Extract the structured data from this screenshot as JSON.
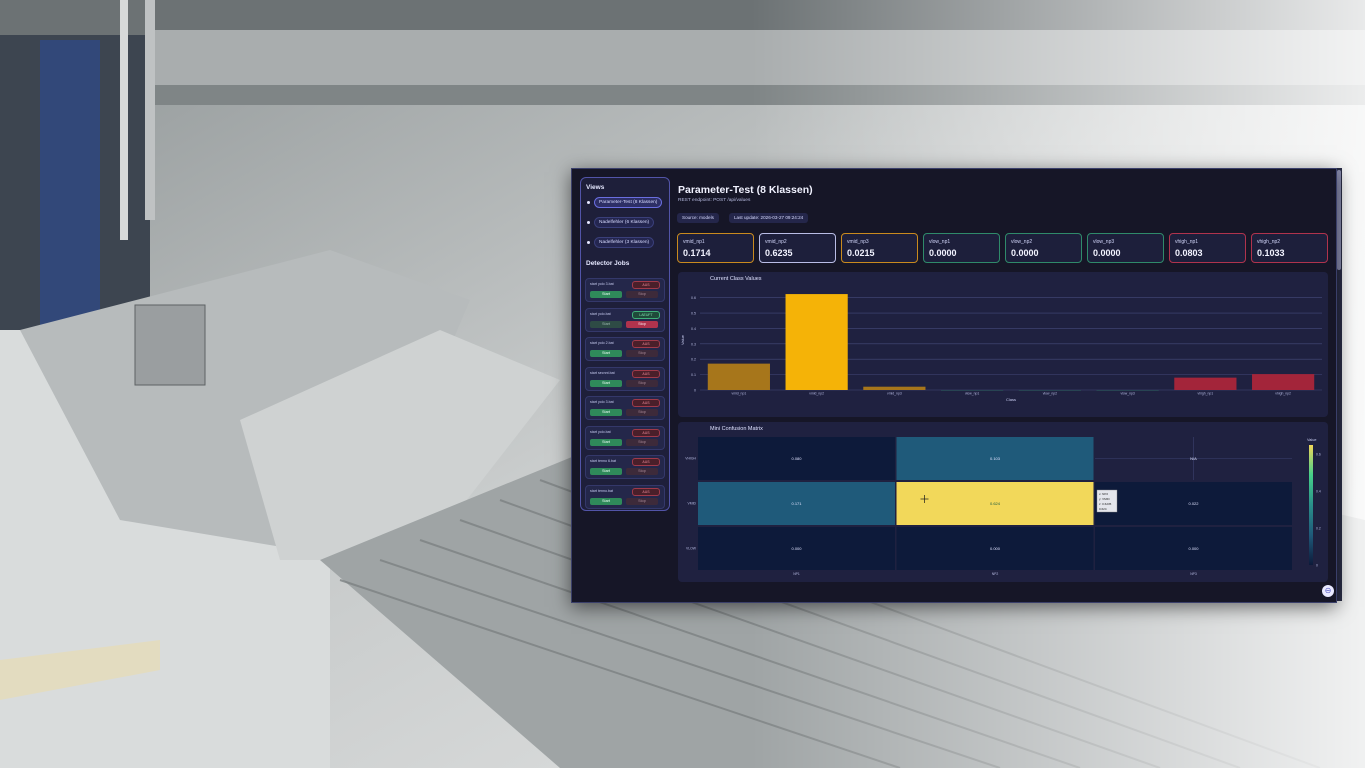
{
  "dashboard": {
    "title": "Parameter-Test (8 Klassen)",
    "subtitle": "REST endpoint: POST /api/values",
    "source_label": "Source: models",
    "last_update_label": "Last update: 2026-03-27 09:24:24"
  },
  "sidebar": {
    "views_heading": "Views",
    "views": [
      {
        "label": "Parameter-Test (8 Klassen)",
        "active": true
      },
      {
        "label": "Nadelfehler (6 Klassen)",
        "active": false
      },
      {
        "label": "Nadelfehler (3 Klassen)",
        "active": false
      }
    ],
    "jobs_heading": "Detector Jobs",
    "start_label": "Start",
    "stop_label": "Stop",
    "jobs": [
      {
        "label": "start yolo 3.bat",
        "status": "AUS"
      },
      {
        "label": "start yolo.bat",
        "status": "LAEUFT"
      },
      {
        "label": "start yolo 2.bat",
        "status": "AUS"
      },
      {
        "label": "start secnnt.bat",
        "status": "AUS"
      },
      {
        "label": "start yolo 3.bat",
        "status": "AUS"
      },
      {
        "label": "start yolo.bat",
        "status": "AUS"
      },
      {
        "label": "start tenno 6.bat",
        "status": "AUS"
      },
      {
        "label": "start tenno.bat",
        "status": "AUS"
      }
    ]
  },
  "metrics": [
    {
      "label": "vmid_np1",
      "value": "0.1714",
      "color": "#c98a1e"
    },
    {
      "label": "vmid_np2",
      "value": "0.6235",
      "color": "#b9bde6"
    },
    {
      "label": "vmid_np3",
      "value": "0.0215",
      "color": "#c98a1e"
    },
    {
      "label": "vlow_np1",
      "value": "0.0000",
      "color": "#2f8a6a"
    },
    {
      "label": "vlow_np2",
      "value": "0.0000",
      "color": "#2f8a6a"
    },
    {
      "label": "vlow_np3",
      "value": "0.0000",
      "color": "#2f8a6a"
    },
    {
      "label": "vhigh_np1",
      "value": "0.0803",
      "color": "#b0334d"
    },
    {
      "label": "vhigh_np2",
      "value": "0.1033",
      "color": "#b0334d"
    }
  ],
  "chart_data": [
    {
      "type": "bar",
      "title": "Current Class Values",
      "xlabel": "Class",
      "ylabel": "Value",
      "categories": [
        "vmid_np1",
        "vmid_np2",
        "vmid_np3",
        "vlow_np1",
        "vlow_np2",
        "vlow_np3",
        "vhigh_np1",
        "vhigh_np2"
      ],
      "values": [
        0.1714,
        0.6235,
        0.0215,
        0.0,
        0.0,
        0.0,
        0.0803,
        0.1033
      ],
      "colors": [
        "#a7761b",
        "#f5b307",
        "#a7761b",
        "#2f8a6a",
        "#2f8a6a",
        "#2f8a6a",
        "#a3253a",
        "#a3253a"
      ],
      "ylim": [
        0,
        0.65
      ],
      "yticks": [
        "0",
        "0.1",
        "0.2",
        "0.3",
        "0.4",
        "0.5",
        "0.6"
      ],
      "grid": true
    },
    {
      "type": "heatmap",
      "title": "Mini Confusion Matrix",
      "rows": [
        "VHIGH",
        "VMID",
        "VLOW"
      ],
      "cols": [
        "NP1",
        "NP2",
        "NP3"
      ],
      "values": [
        [
          0.08,
          0.103,
          null
        ],
        [
          0.171,
          0.624,
          0.022
        ],
        [
          0.0,
          0.0,
          0.0
        ]
      ],
      "cell_labels": [
        [
          "0.080",
          "0.103",
          "N/A"
        ],
        [
          "0.171",
          "0.624",
          "0.022"
        ],
        [
          "0.000",
          "0.000",
          "0.000"
        ]
      ],
      "colorbar_title": "Value",
      "colorbar_ticks": [
        "0.6",
        "0.4",
        "0.2",
        "0"
      ],
      "colorscale": [
        "#0d1a3a",
        "#1f5a7a",
        "#2a8f8a",
        "#46d08a",
        "#f2d85a"
      ],
      "tooltip": [
        "x: NP2",
        "y: VMID",
        "z: 0.6235",
        "0.624"
      ]
    }
  ]
}
